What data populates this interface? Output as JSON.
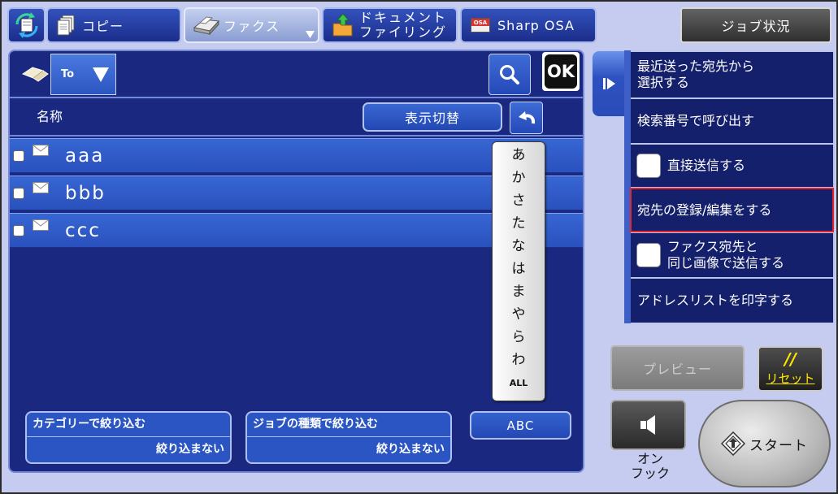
{
  "header": {
    "home_icon": "home-icon",
    "tabs": [
      {
        "id": "copy",
        "label": "コピー",
        "icon": "copy-icon",
        "selected": false
      },
      {
        "id": "fax",
        "label": "ファクス",
        "icon": "fax-icon",
        "selected": true
      },
      {
        "id": "document-filing",
        "label_lines": [
          "ドキュメント",
          "ファイリング"
        ],
        "icon": "folder-upload-icon",
        "selected": false
      },
      {
        "id": "sharp-osa",
        "label": "Sharp OSA",
        "icon": "osa-icon",
        "icon_text": "OSA",
        "selected": false
      }
    ],
    "job_status_label": "ジョブ状況"
  },
  "address_book": {
    "recipient_type": "To",
    "ok_label": "OK",
    "name_column": "名称",
    "display_toggle_label": "表示切替",
    "entries": [
      {
        "name": "aaa",
        "icon": "envelope-icon",
        "checked": false
      },
      {
        "name": "bbb",
        "icon": "envelope-icon",
        "checked": false
      },
      {
        "name": "ccc",
        "icon": "envelope-icon",
        "checked": false
      }
    ],
    "index_tabs": [
      "あ",
      "か",
      "さ",
      "た",
      "な",
      "は",
      "ま",
      "や",
      "ら",
      "わ",
      "ALL"
    ],
    "filters": [
      {
        "title": "カテゴリーで絞り込む",
        "value": "絞り込まない"
      },
      {
        "title": "ジョブの種類で絞り込む",
        "value": "絞り込まない"
      }
    ],
    "abc_label": "ABC"
  },
  "action_panel": {
    "items": [
      {
        "lines": [
          "最近送った宛先から",
          "選択する"
        ]
      },
      {
        "lines": [
          "検索番号で呼び出す"
        ]
      },
      {
        "lines": [
          "直接送信する"
        ],
        "checkbox": true,
        "checked": false
      },
      {
        "lines": [
          "宛先の登録/編集をする"
        ],
        "highlighted": true
      },
      {
        "lines": [
          "ファクス宛先と",
          "同じ画像で送信する"
        ],
        "checkbox": true,
        "checked": false
      },
      {
        "lines": [
          "アドレスリストを印字する"
        ]
      }
    ]
  },
  "controls": {
    "preview_label": "プレビュー",
    "preview_enabled": false,
    "reset_mark": "//",
    "reset_label": "リセット",
    "onhook_lines": [
      "オン",
      "フック"
    ],
    "start_label": "スタート"
  },
  "colors": {
    "background": "#c6ccef",
    "panel": "#1a2880",
    "row": "#2f5bc8",
    "action_item": "#15206c",
    "highlight_border": "#e3262e",
    "reset_text": "#ffe600"
  }
}
